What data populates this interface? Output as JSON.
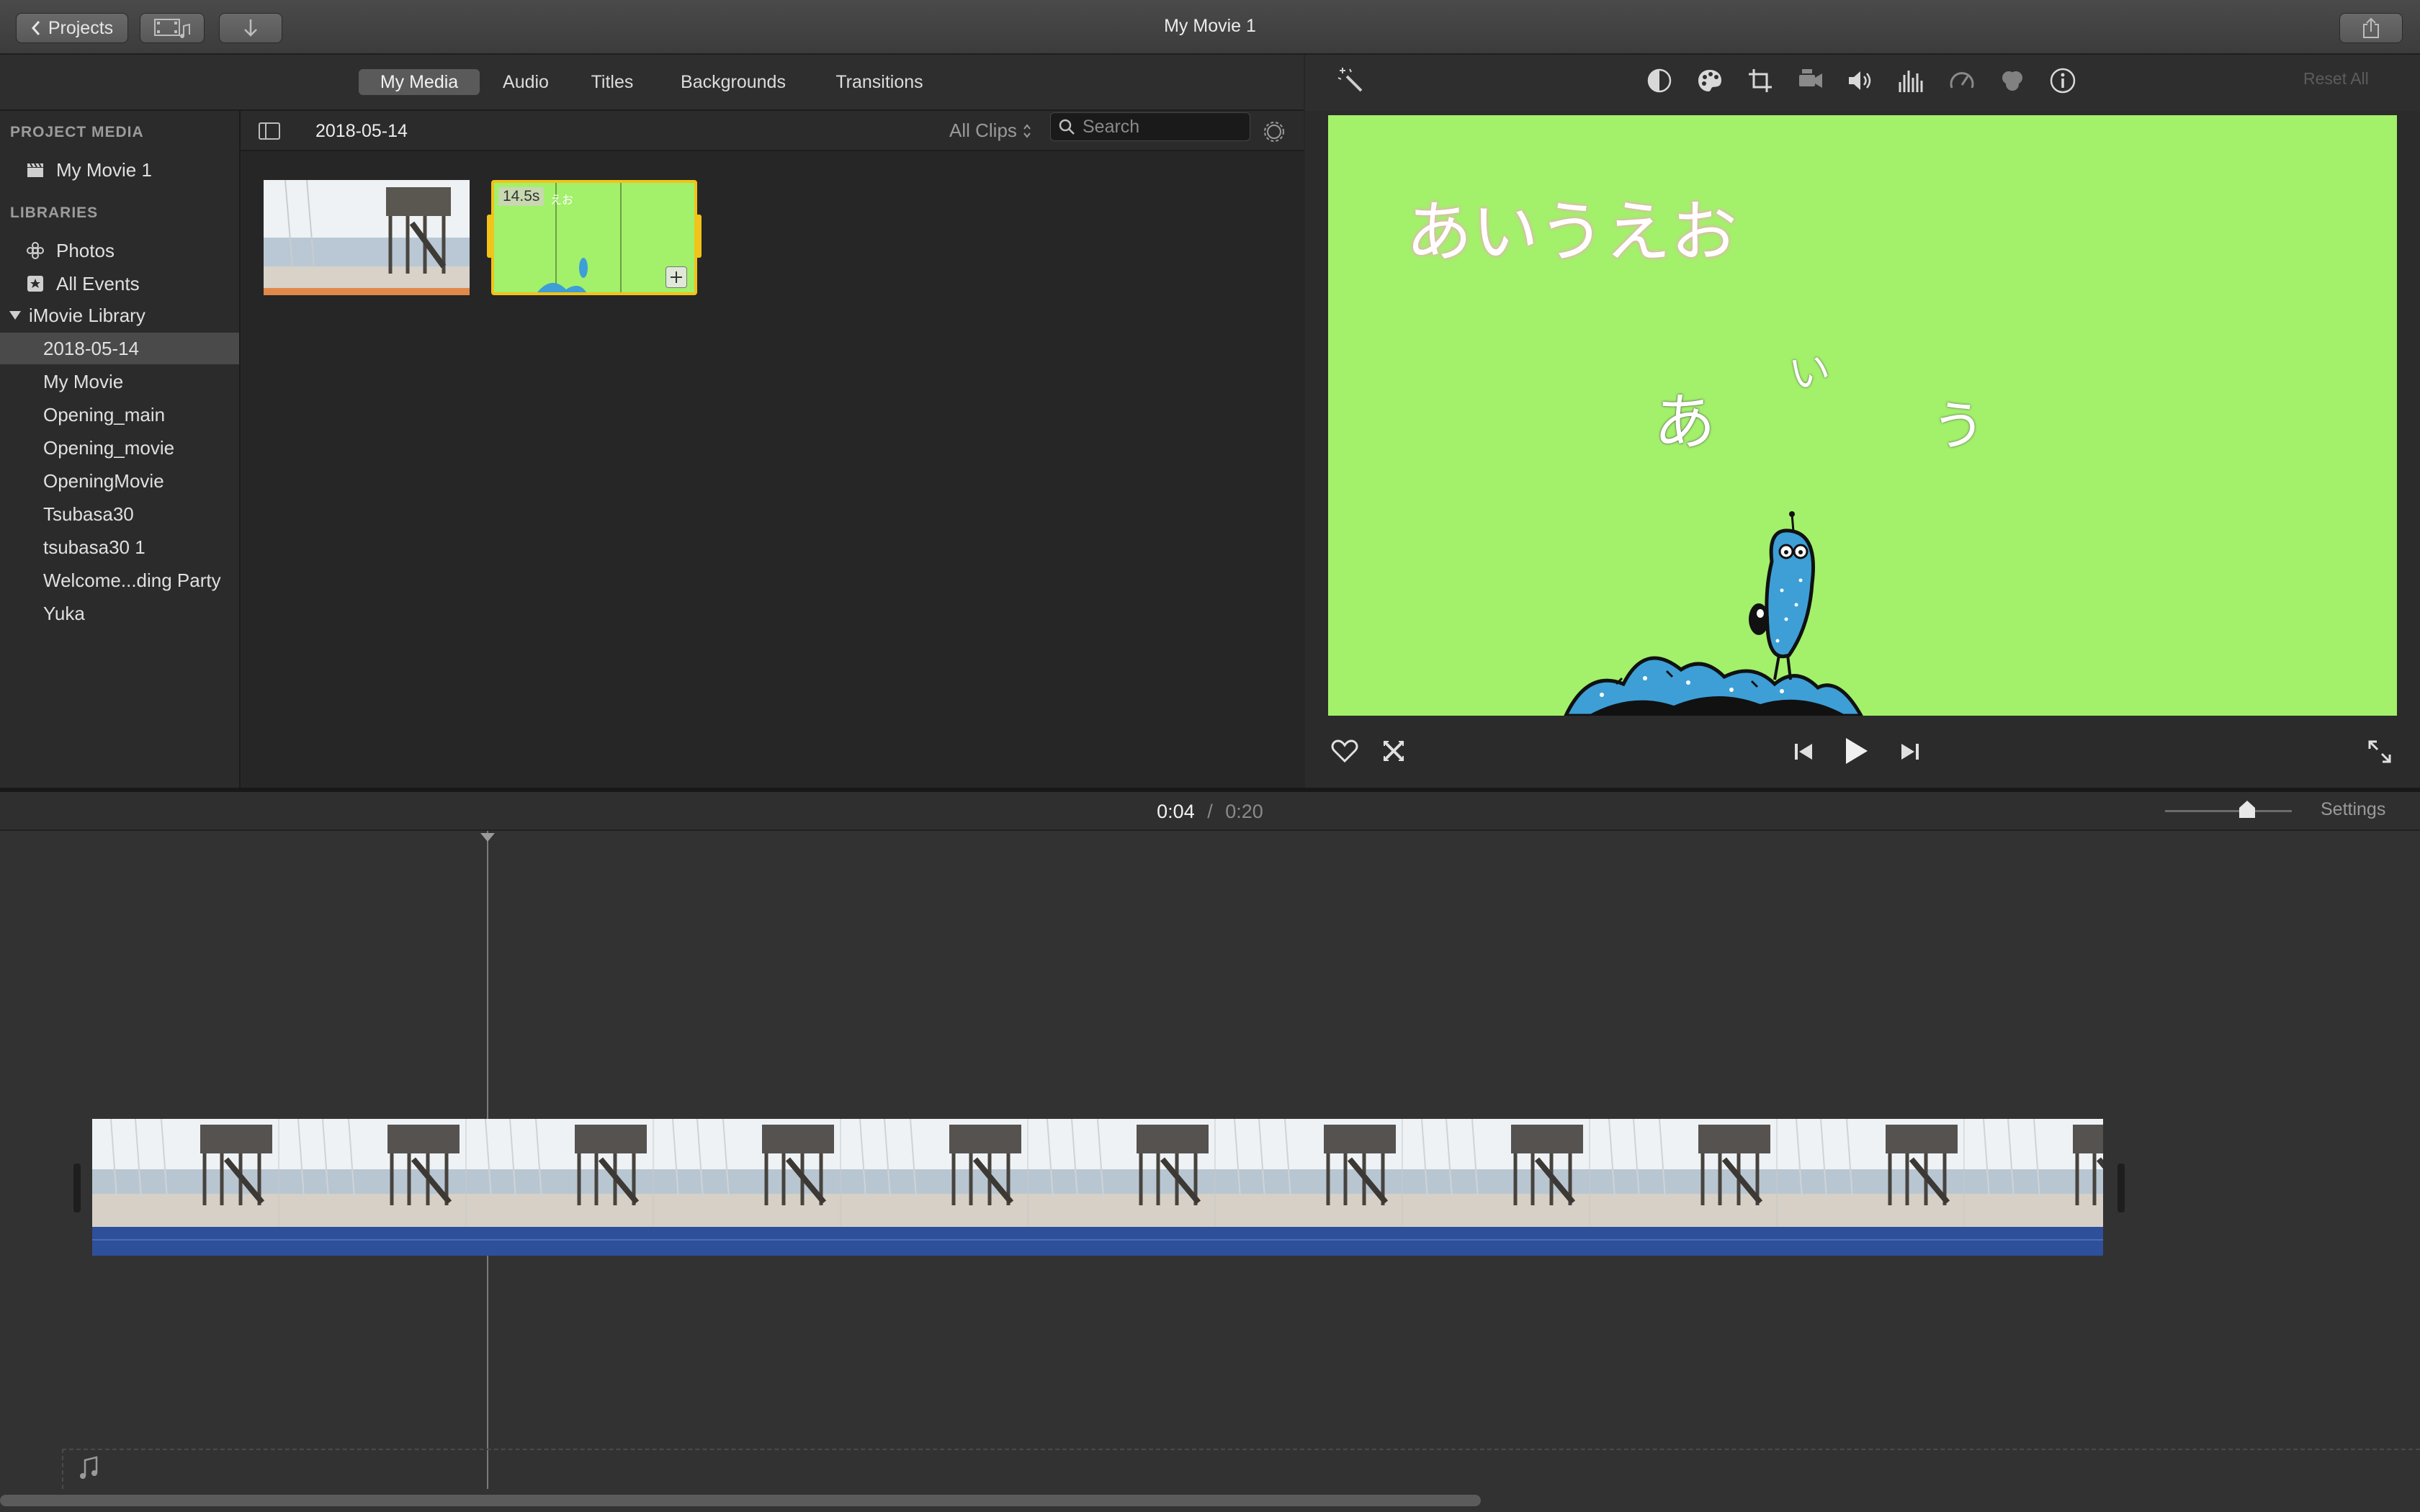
{
  "window": {
    "title": "My Movie 1"
  },
  "toolbar": {
    "projects_label": "Projects",
    "projects_icon": "chevron-left-icon",
    "media_icon": "film-music-icon",
    "import_icon": "arrow-down-icon",
    "share_icon": "share-icon"
  },
  "browser_tabs": [
    {
      "label": "My Media",
      "active": true
    },
    {
      "label": "Audio",
      "active": false
    },
    {
      "label": "Titles",
      "active": false
    },
    {
      "label": "Backgrounds",
      "active": false
    },
    {
      "label": "Transitions",
      "active": false
    }
  ],
  "sidebar": {
    "project_media_heading": "PROJECT MEDIA",
    "project_item": "My Movie 1",
    "libraries_heading": "LIBRARIES",
    "photos": "Photos",
    "all_events": "All Events",
    "library_name": "iMovie Library",
    "events": [
      "2018-05-14",
      "My Movie",
      "Opening_main",
      "Opening_movie",
      "OpeningMovie",
      "Tsubasa30",
      "tsubasa30 1",
      "Welcome...ding Party",
      "Yuka"
    ],
    "selected_event": "2018-05-14"
  },
  "browser": {
    "current_event": "2018-05-14",
    "filter": "All Clips",
    "search_placeholder": "Search",
    "clips": [
      {
        "kind": "beach-pier"
      },
      {
        "kind": "green-title",
        "duration": "14.5s",
        "mini_text": "えお"
      }
    ]
  },
  "viewer": {
    "reset_label": "Reset All",
    "tools": [
      "magic-wand-icon",
      "color-balance-icon",
      "color-palette-icon",
      "crop-icon",
      "stabilization-icon",
      "volume-icon",
      "equalizer-icon",
      "speedometer-icon",
      "filter-icon",
      "info-icon"
    ],
    "title_text": "あいうえお",
    "anim_chars": [
      "あ",
      "い",
      "う"
    ],
    "background_color": "#a3f06b"
  },
  "playback": {
    "current_time": "0:04",
    "separator": "/",
    "total_time": "0:20",
    "settings_label": "Settings",
    "zoom_level": 0.65
  },
  "colors": {
    "accent_blue": "#2e4f9a",
    "selection_yellow": "#f2c318",
    "clip_green": "#a3f06b"
  }
}
